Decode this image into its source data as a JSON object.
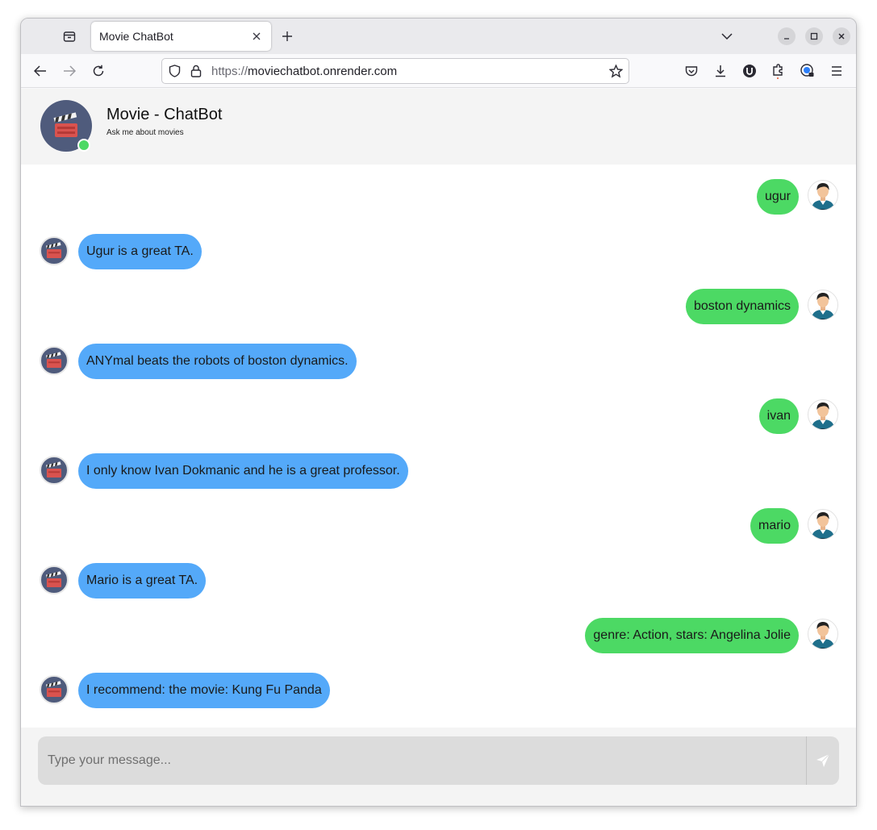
{
  "browser": {
    "tab_title": "Movie ChatBot",
    "url_scheme": "https://",
    "url_host": "moviechatbot.onrender.com"
  },
  "chat": {
    "title": "Movie - ChatBot",
    "subtitle": "Ask me about movies",
    "status": "online"
  },
  "messages": [
    {
      "from": "user",
      "text": "ugur"
    },
    {
      "from": "bot",
      "text": "Ugur is a great TA."
    },
    {
      "from": "user",
      "text": "boston dynamics"
    },
    {
      "from": "bot",
      "text": "ANYmal beats the robots of boston dynamics."
    },
    {
      "from": "user",
      "text": "ivan"
    },
    {
      "from": "bot",
      "text": "I only know Ivan Dokmanic and he is a great professor."
    },
    {
      "from": "user",
      "text": "mario"
    },
    {
      "from": "bot",
      "text": "Mario is a great TA."
    },
    {
      "from": "user",
      "text": "genre: Action, stars: Angelina Jolie"
    },
    {
      "from": "bot",
      "text": "I recommend: the movie: Kung Fu Panda"
    }
  ],
  "composer": {
    "placeholder": "Type your message..."
  },
  "colors": {
    "user_bubble": "#4cd964",
    "bot_bubble": "#54a9f9",
    "header_avatar": "#4f5b7c",
    "online_dot": "#4cd964"
  },
  "icons": {
    "bot_avatar": "movie-clapperboard-icon",
    "user_avatar": "man-portrait-icon",
    "send": "paper-plane-icon"
  }
}
